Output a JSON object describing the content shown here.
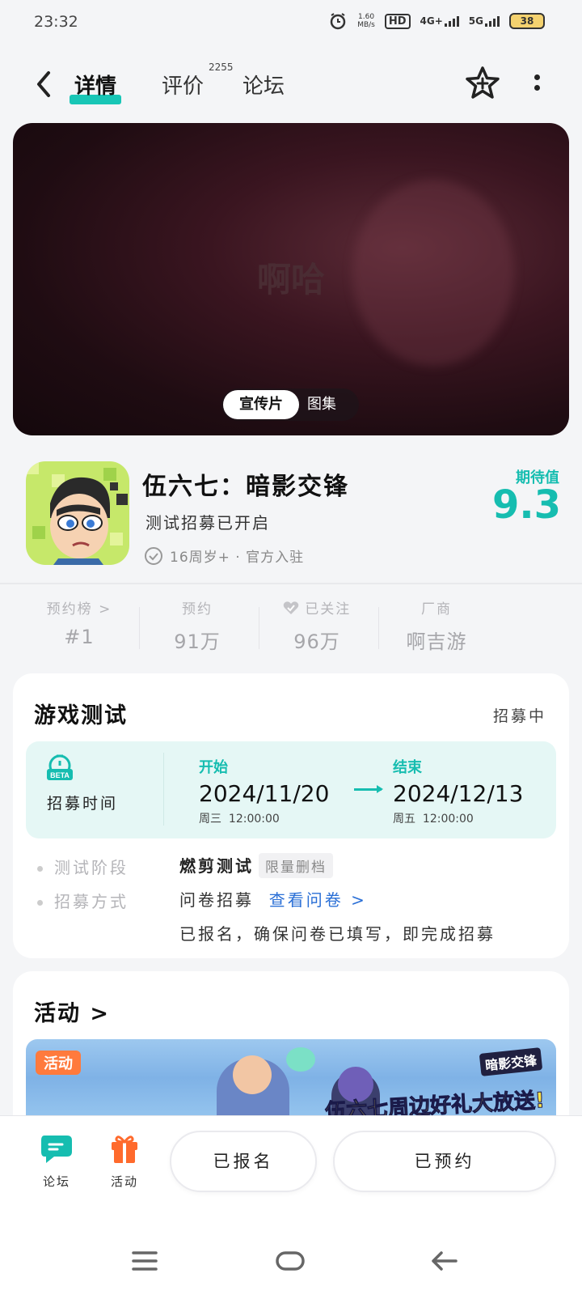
{
  "status_bar": {
    "time": "23:32",
    "net_speed_value": "1.60",
    "net_speed_unit": "MB/s",
    "hd_label": "HD",
    "net_4g": "4G+",
    "net_5g": "5G",
    "battery": "38"
  },
  "nav": {
    "tabs": [
      {
        "label": "详情"
      },
      {
        "label": "评价"
      },
      {
        "label": "论坛"
      }
    ],
    "review_count": "2255"
  },
  "banner": {
    "center_text": "啊哈",
    "segment_on": "宣传片",
    "segment_off": "图集"
  },
  "game": {
    "title": "伍六七：暗影交锋",
    "subtitle": "测试招募已开启",
    "meta": "16周岁+ · 官方入驻",
    "expectation_label": "期待值",
    "expectation_value": "9.3"
  },
  "stats": [
    {
      "label": "预约榜 >",
      "value": "#1"
    },
    {
      "label": "预约",
      "value": "91万"
    },
    {
      "label": "已关注",
      "value": "96万"
    },
    {
      "label": "厂商",
      "value": "啊吉游"
    }
  ],
  "test_card": {
    "title": "游戏测试",
    "status": "招募中",
    "recruit_label": "招募时间",
    "beta_text": "BETA",
    "start": {
      "key": "开始",
      "date": "2024/11/20",
      "weekday": "周三",
      "time": "12:00:00"
    },
    "end": {
      "key": "结束",
      "date": "2024/12/13",
      "weekday": "周五",
      "time": "12:00:00"
    },
    "phase_key": "测试阶段",
    "phase_value": "燃剪测试",
    "phase_tag": "限量删档",
    "method_key": "招募方式",
    "method_value": "问卷招募",
    "method_link": "查看问卷 >",
    "method_note": "已报名，确保问卷已填写，即完成招募"
  },
  "activity_card": {
    "title": "活动 >",
    "badge": "活动",
    "banner_text": "伍六七周边好礼大放送!",
    "logo_text": "暗影交锋"
  },
  "bottom_bar": {
    "forum_label": "论坛",
    "activity_label": "活动",
    "registered_label": "已报名",
    "reserved_label": "已预约"
  },
  "colors": {
    "accent": "#16bdb0",
    "link": "#2a6fd6",
    "badge_orange": "#ff7a3d"
  }
}
